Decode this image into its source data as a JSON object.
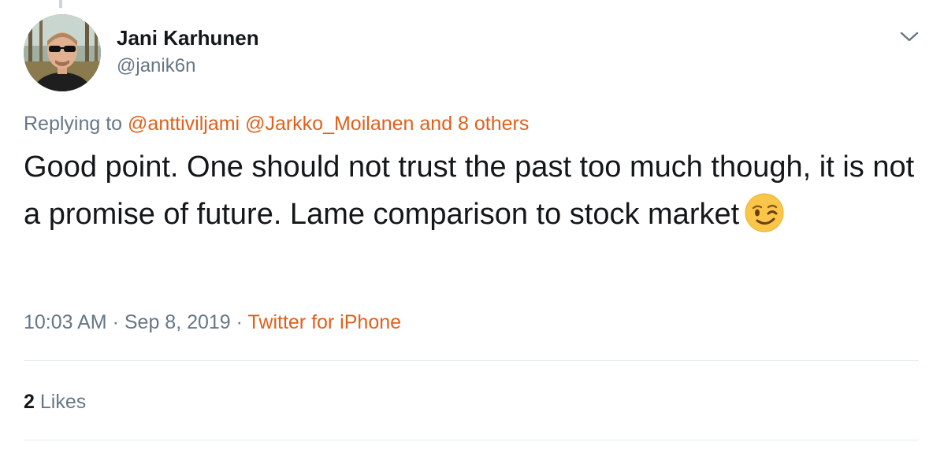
{
  "tweet": {
    "author": {
      "display_name": "Jani Karhunen",
      "handle": "@janik6n"
    },
    "reply": {
      "prefix": "Replying to",
      "mention_1": "@anttiviljami",
      "mention_2": "@Jarkko_Moilanen",
      "others": "and 8 others"
    },
    "text": "Good point. One should not trust the past too much though, it is not a promise of future. Lame comparison to stock market",
    "emoji": "winking-face",
    "time": "10:03 AM",
    "separator": "·",
    "date": "Sep 8, 2019",
    "source": "Twitter for iPhone",
    "likes_count": "2",
    "likes_label": "Likes"
  },
  "colors": {
    "link": "#e0601c",
    "secondary_text": "#657786",
    "primary_text": "#14171a",
    "divider": "#e6ecf0"
  }
}
